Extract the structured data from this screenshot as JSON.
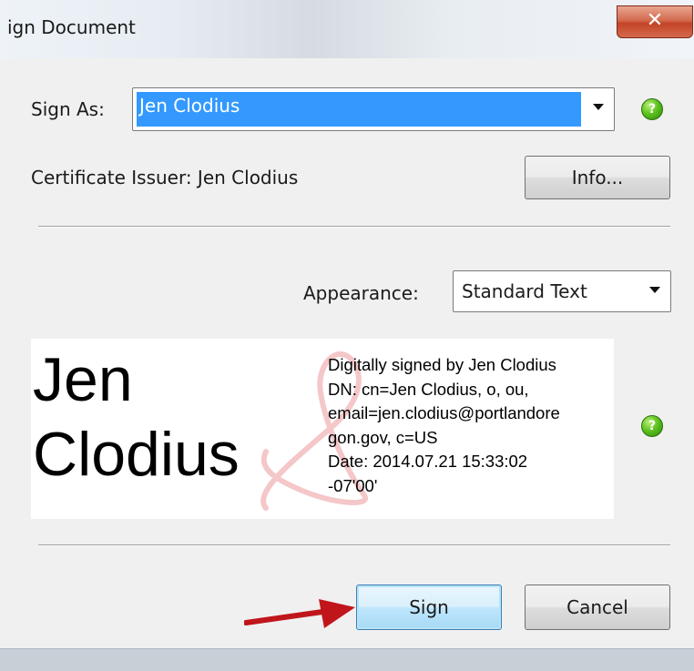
{
  "window": {
    "title": "ign Document",
    "close_glyph": "✕"
  },
  "sign_as": {
    "label": "Sign As:",
    "selected": "Jen Clodius",
    "certificate_issuer": "Certificate Issuer: Jen Clodius",
    "info_button": "Info..."
  },
  "appearance": {
    "label": "Appearance:",
    "selected": "Standard Text"
  },
  "preview": {
    "name_lines": [
      "Jen",
      "Clodius"
    ],
    "details": [
      "Digitally signed by Jen Clodius",
      "DN: cn=Jen Clodius, o, ou,",
      "email=jen.clodius@portlandore",
      "gon.gov, c=US",
      "Date: 2014.07.21 15:33:02",
      "-07'00'"
    ],
    "watermark_icon": "adobe-acrobat-logo"
  },
  "help_glyph": "?",
  "buttons": {
    "sign": "Sign",
    "cancel": "Cancel"
  },
  "colors": {
    "selection": "#3399ff",
    "help_green": "#5fc31e",
    "arrow_red": "#c0161b",
    "close_red": "#c34428"
  }
}
